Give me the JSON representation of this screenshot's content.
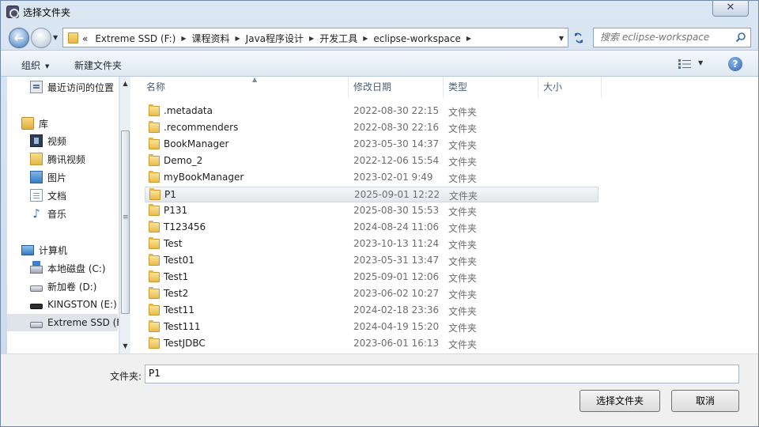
{
  "window": {
    "title": "选择文件夹",
    "close_glyph": "✕"
  },
  "address": {
    "nav_back_glyph": "←",
    "nav_fwd_glyph": "→",
    "overflow_glyph": "«",
    "crumbs": [
      "Extreme SSD (F:)",
      "课程资料",
      "Java程序设计",
      "开发工具",
      "eclipse-workspace"
    ],
    "search_placeholder": "搜索 eclipse-workspace"
  },
  "toolbar": {
    "organize": "组织",
    "new_folder": "新建文件夹",
    "help": "?"
  },
  "sidebar": {
    "items": [
      {
        "label": "最近访问的位置",
        "icon": "recent-places-icon",
        "indent": 1
      },
      {
        "label": "库",
        "icon": "library-icon",
        "indent": 0
      },
      {
        "label": "视频",
        "icon": "video-icon",
        "indent": 1
      },
      {
        "label": "腾讯视频",
        "icon": "tencent-video-icon",
        "indent": 1
      },
      {
        "label": "图片",
        "icon": "pictures-icon",
        "indent": 1
      },
      {
        "label": "文档",
        "icon": "documents-icon",
        "indent": 1
      },
      {
        "label": "音乐",
        "icon": "music-icon",
        "indent": 1
      },
      {
        "label": "计算机",
        "icon": "computer-icon",
        "indent": 0
      },
      {
        "label": "本地磁盘 (C:)",
        "icon": "system-drive-icon",
        "indent": 1
      },
      {
        "label": "新加卷 (D:)",
        "icon": "drive-icon",
        "indent": 1
      },
      {
        "label": "KINGSTON (E:)",
        "icon": "usb-drive-icon",
        "indent": 1
      },
      {
        "label": "Extreme SSD (F",
        "icon": "drive-icon",
        "indent": 1,
        "selected": true
      }
    ]
  },
  "columns": {
    "name": "名称",
    "date": "修改日期",
    "type": "类型",
    "size": "大小"
  },
  "files": [
    {
      "name": ".metadata",
      "date": "2022-08-30 22:15",
      "type": "文件夹"
    },
    {
      "name": ".recommenders",
      "date": "2022-08-30 22:16",
      "type": "文件夹"
    },
    {
      "name": "BookManager",
      "date": "2023-05-30 14:37",
      "type": "文件夹"
    },
    {
      "name": "Demo_2",
      "date": "2022-12-06 15:54",
      "type": "文件夹"
    },
    {
      "name": "myBookManager",
      "date": "2023-02-01 9:49",
      "type": "文件夹"
    },
    {
      "name": "P1",
      "date": "2025-09-01 12:22",
      "type": "文件夹",
      "selected": true
    },
    {
      "name": "P131",
      "date": "2025-08-30 15:53",
      "type": "文件夹"
    },
    {
      "name": "T123456",
      "date": "2024-08-24 11:06",
      "type": "文件夹"
    },
    {
      "name": "Test",
      "date": "2023-10-13 11:24",
      "type": "文件夹"
    },
    {
      "name": "Test01",
      "date": "2023-05-31 13:47",
      "type": "文件夹"
    },
    {
      "name": "Test1",
      "date": "2025-09-01 12:06",
      "type": "文件夹"
    },
    {
      "name": "Test2",
      "date": "2023-06-02 10:27",
      "type": "文件夹"
    },
    {
      "name": "Test11",
      "date": "2024-02-18 23:36",
      "type": "文件夹"
    },
    {
      "name": "Test111",
      "date": "2024-04-19 15:20",
      "type": "文件夹"
    },
    {
      "name": "TestJDBC",
      "date": "2023-06-01 16:13",
      "type": "文件夹"
    }
  ],
  "bottom": {
    "folder_label": "文件夹:",
    "folder_value": "P1",
    "select_button": "选择文件夹",
    "cancel_button": "取消"
  }
}
